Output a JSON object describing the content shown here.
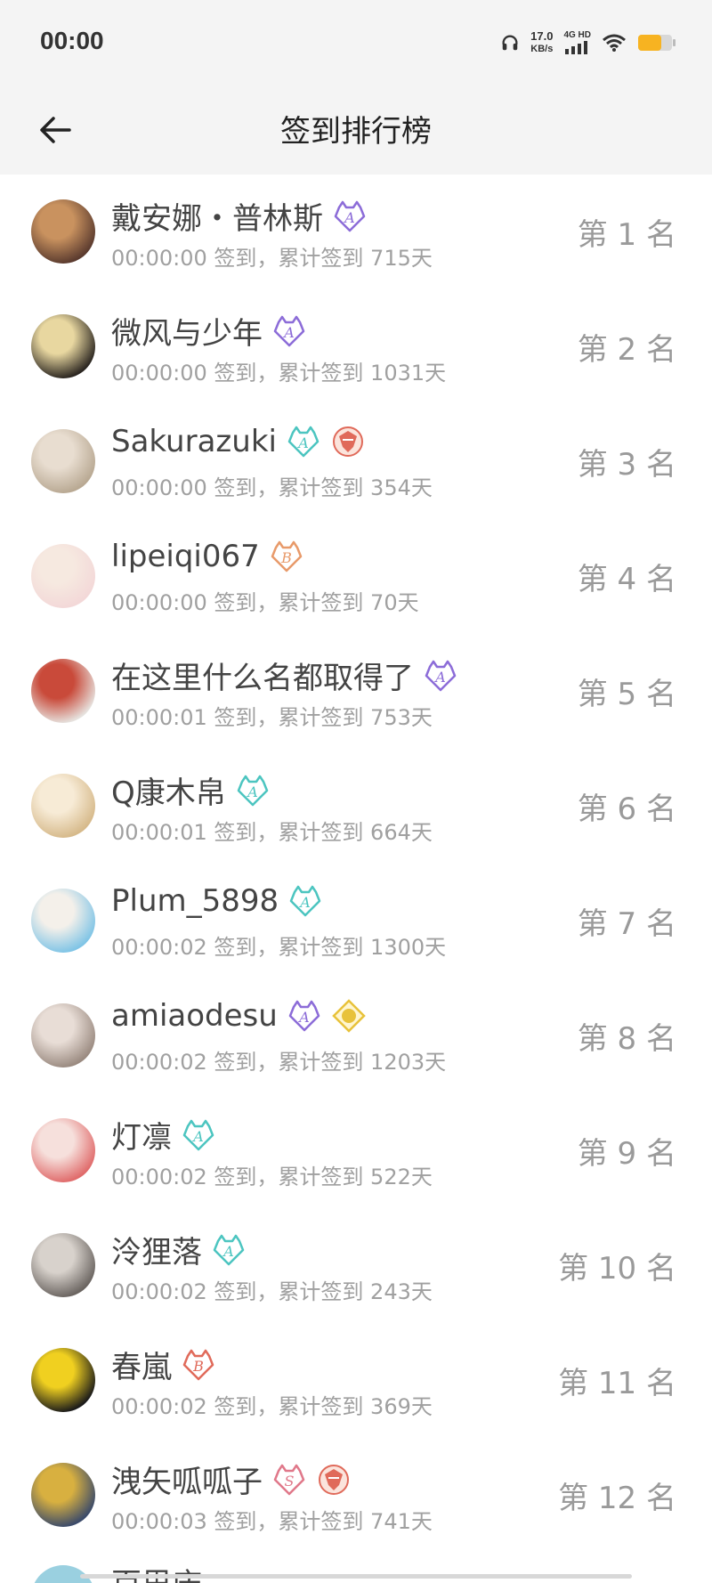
{
  "status_bar": {
    "time": "00:00",
    "speed_value": "17.0",
    "speed_unit": "KB/s",
    "network_type": "4G HD",
    "icons": [
      "headphones-icon",
      "signal-icon",
      "wifi-icon",
      "battery-icon"
    ],
    "battery_color": "#f7b321"
  },
  "header": {
    "title": "签到排行榜",
    "back_icon": "arrow-left-icon"
  },
  "list": {
    "items": [
      {
        "name": "戴安娜・普林斯",
        "meta": "00:00:00 签到，累计签到 715天",
        "rank": "第 1 名",
        "badges": [
          {
            "type": "A",
            "color": "#8c6cd8"
          }
        ],
        "avatar_colors": [
          "#5a3a2e",
          "#c9925f"
        ]
      },
      {
        "name": "微风与少年",
        "meta": "00:00:00 签到，累计签到 1031天",
        "rank": "第 2 名",
        "badges": [
          {
            "type": "A",
            "color": "#8c6cd8"
          }
        ],
        "avatar_colors": [
          "#2a2520",
          "#e8d7a0"
        ]
      },
      {
        "name": "Sakurazuki",
        "meta": "00:00:00 签到，累计签到 354天",
        "rank": "第 3 名",
        "badges": [
          {
            "type": "A",
            "color": "#4cc5c0"
          },
          {
            "type": "crest",
            "color": "#e06a5a"
          }
        ],
        "avatar_colors": [
          "#b8a892",
          "#e8ddd0"
        ]
      },
      {
        "name": "lipeiqi067",
        "meta": "00:00:00 签到，累计签到 70天",
        "rank": "第 4 名",
        "badges": [
          {
            "type": "B",
            "color": "#e89a6a"
          }
        ],
        "avatar_colors": [
          "#f3d8d8",
          "#f6e9e0"
        ]
      },
      {
        "name": "在这里什么名都取得了",
        "meta": "00:00:01 签到，累计签到 753天",
        "rank": "第 5 名",
        "badges": [
          {
            "type": "A",
            "color": "#8c6cd8"
          }
        ],
        "avatar_colors": [
          "#e6e2de",
          "#c94a3a"
        ]
      },
      {
        "name": "Q康木帛",
        "meta": "00:00:01 签到，累计签到 664天",
        "rank": "第 6 名",
        "badges": [
          {
            "type": "A",
            "color": "#4cc5c0"
          }
        ],
        "avatar_colors": [
          "#d6b98a",
          "#f7ebd6"
        ]
      },
      {
        "name": "Plum_5898",
        "meta": "00:00:02 签到，累计签到 1300天",
        "rank": "第 7 名",
        "badges": [
          {
            "type": "A",
            "color": "#4cc5c0"
          }
        ],
        "avatar_colors": [
          "#7fc4e6",
          "#f4f0ea"
        ]
      },
      {
        "name": "amiaodesu",
        "meta": "00:00:02 签到，累计签到 1203天",
        "rank": "第 8 名",
        "badges": [
          {
            "type": "A",
            "color": "#8c6cd8"
          },
          {
            "type": "gold",
            "color": "#e8c23a"
          }
        ],
        "avatar_colors": [
          "#9a8a80",
          "#e8ddd6"
        ]
      },
      {
        "name": "灯凛",
        "meta": "00:00:02 签到，累计签到 522天",
        "rank": "第 9 名",
        "badges": [
          {
            "type": "A",
            "color": "#4cc5c0"
          }
        ],
        "avatar_colors": [
          "#e06a6a",
          "#f6e0dc"
        ]
      },
      {
        "name": "泠狸落",
        "meta": "00:00:02 签到，累计签到 243天",
        "rank": "第 10 名",
        "badges": [
          {
            "type": "A",
            "color": "#4cc5c0"
          }
        ],
        "avatar_colors": [
          "#6a6460",
          "#d8d2cc"
        ]
      },
      {
        "name": "春嵐",
        "meta": "00:00:02 签到，累计签到 369天",
        "rank": "第 11 名",
        "badges": [
          {
            "type": "B",
            "color": "#e06a5a"
          }
        ],
        "avatar_colors": [
          "#1a1a1a",
          "#f0d020"
        ]
      },
      {
        "name": "洩矢呱呱子",
        "meta": "00:00:03 签到，累计签到 741天",
        "rank": "第 12 名",
        "badges": [
          {
            "type": "S",
            "color": "#e0788a"
          },
          {
            "type": "crest",
            "color": "#e06a5a"
          }
        ],
        "avatar_colors": [
          "#3a4a6a",
          "#d8b040"
        ]
      }
    ],
    "peek_name": "百里庆"
  }
}
